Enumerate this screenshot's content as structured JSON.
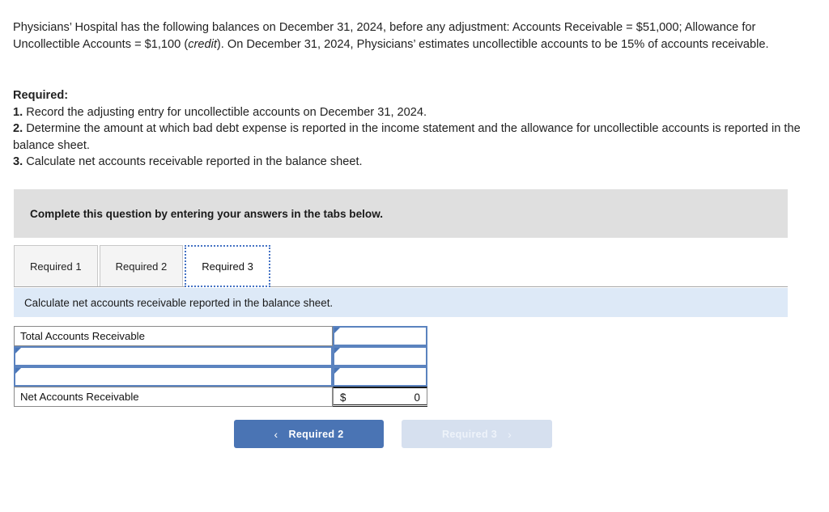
{
  "problem": {
    "text_part1": "Physicians’ Hospital has the following balances on December 31, 2024, before any adjustment: Accounts Receivable = $51,000; Allowance for Uncollectible Accounts = $1,100 (",
    "italic_word": "credit",
    "text_part2": "). On December 31, 2024, Physicians’ estimates uncollectible accounts to be 15% of accounts receivable."
  },
  "required": {
    "heading": "Required:",
    "items": [
      {
        "num": "1.",
        "text": " Record the adjusting entry for uncollectible accounts on December 31, 2024."
      },
      {
        "num": "2.",
        "text": " Determine the amount at which bad debt expense is reported in the income statement and the allowance for uncollectible accounts is reported in the balance sheet."
      },
      {
        "num": "3.",
        "text": " Calculate net accounts receivable reported in the balance sheet."
      }
    ]
  },
  "banner": {
    "instruction": "Complete this question by entering your answers in the tabs below."
  },
  "tabs": [
    {
      "label": "Required 1",
      "active": false
    },
    {
      "label": "Required 2",
      "active": false
    },
    {
      "label": "Required 3",
      "active": true
    }
  ],
  "sub_instruction": "Calculate net accounts receivable reported in the balance sheet.",
  "table": {
    "rows": [
      {
        "label": "Total Accounts Receivable",
        "label_editable": false,
        "value": "",
        "value_editable": true
      },
      {
        "label": "",
        "label_editable": true,
        "value": "",
        "value_editable": true
      },
      {
        "label": "",
        "label_editable": true,
        "value": "",
        "value_editable": true
      }
    ],
    "total_row": {
      "label": "Net Accounts Receivable",
      "currency": "$",
      "amount": "0"
    },
    "placeholder": ""
  },
  "navigation": {
    "prev_label": "Required 2",
    "prev_chevron": "‹",
    "next_label": "Required 3",
    "next_chevron": "›"
  },
  "colors": {
    "accent_blue": "#4a74b4",
    "disabled_blue": "#d6e0ef",
    "banner_gray": "#dfdfdf",
    "sub_bar_blue": "#dde9f7",
    "cell_border_blue": "#5b83bf"
  }
}
